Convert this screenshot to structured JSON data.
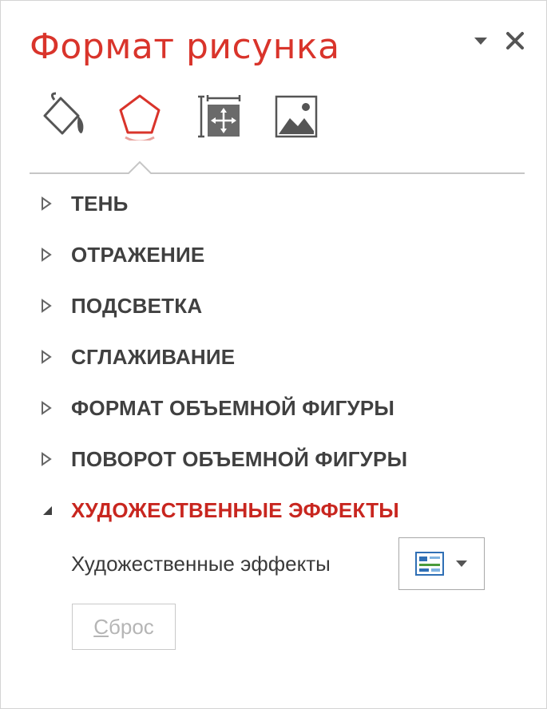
{
  "pane": {
    "title": "Формат рисунка",
    "accent_color": "#d9342b",
    "header_icons": [
      "dropdown-arrow-icon",
      "close-icon"
    ]
  },
  "tabs": [
    {
      "name": "fill-line",
      "icon": "paint-bucket-icon",
      "active": false
    },
    {
      "name": "effects",
      "icon": "pentagon-icon",
      "active": true
    },
    {
      "name": "size-properties",
      "icon": "size-position-icon",
      "active": false
    },
    {
      "name": "picture",
      "icon": "picture-icon",
      "active": false
    }
  ],
  "sections": [
    {
      "label": "ТЕНЬ",
      "expanded": false
    },
    {
      "label": "ОТРАЖЕНИЕ",
      "expanded": false
    },
    {
      "label": "ПОДСВЕТКА",
      "expanded": false
    },
    {
      "label": "СГЛАЖИВАНИЕ",
      "expanded": false
    },
    {
      "label": "ФОРМАТ ОБЪЕМНОЙ ФИГУРЫ",
      "expanded": false
    },
    {
      "label": "ПОВОРОТ ОБЪЕМНОЙ ФИГУРЫ",
      "expanded": false
    },
    {
      "label": "ХУДОЖЕСТВЕННЫЕ ЭФФЕКТЫ",
      "expanded": true
    }
  ],
  "artistic_effects": {
    "label": "Художественные эффекты",
    "picker_icon": "artistic-effect-thumbnail-icon"
  },
  "reset_button": {
    "mnemonic": "С",
    "rest": "брос",
    "enabled": false
  }
}
